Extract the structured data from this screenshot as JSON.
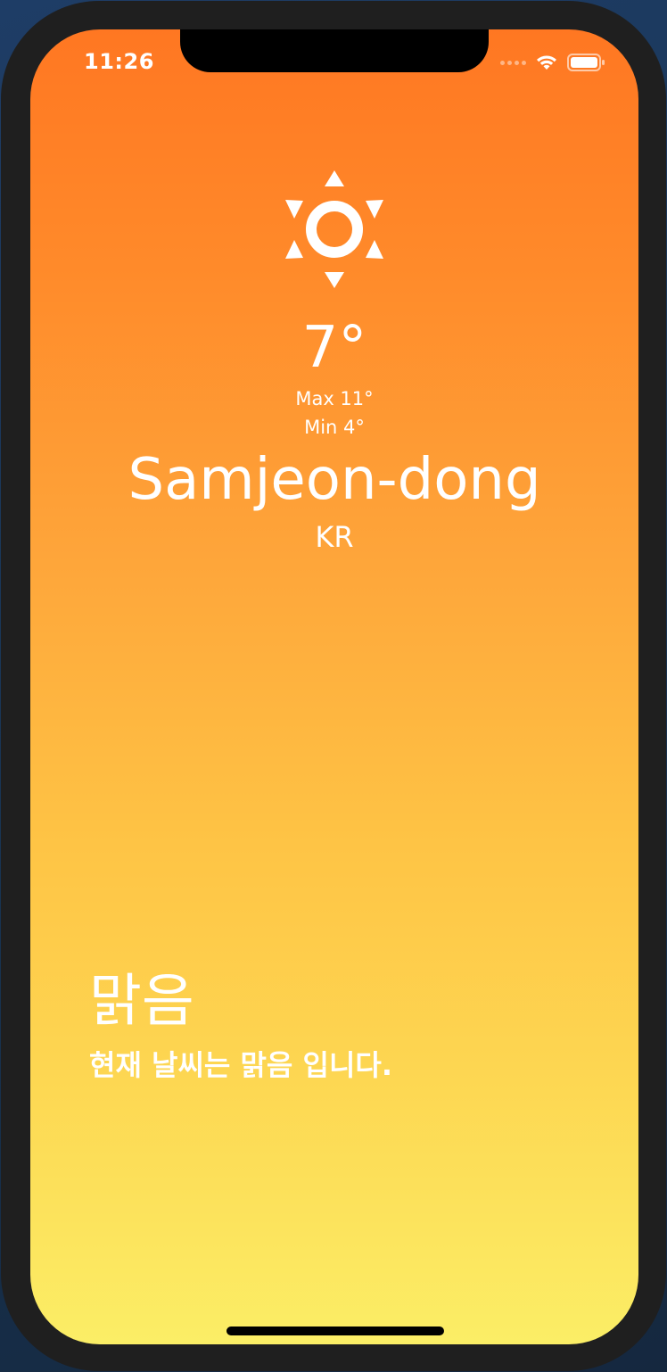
{
  "status_bar": {
    "time": "11:26"
  },
  "weather": {
    "icon": "sun-icon",
    "temperature": "7°",
    "max": "Max 11°",
    "min": "Min 4°",
    "city": "Samjeon-dong",
    "country": "KR",
    "condition": "맑음",
    "description": "현재 날씨는 맑음 입니다."
  },
  "colors": {
    "gradient_top": "#ff7722",
    "gradient_bottom": "#fbee66",
    "text": "#ffffff",
    "phone_frame": "#1f1f1f"
  }
}
